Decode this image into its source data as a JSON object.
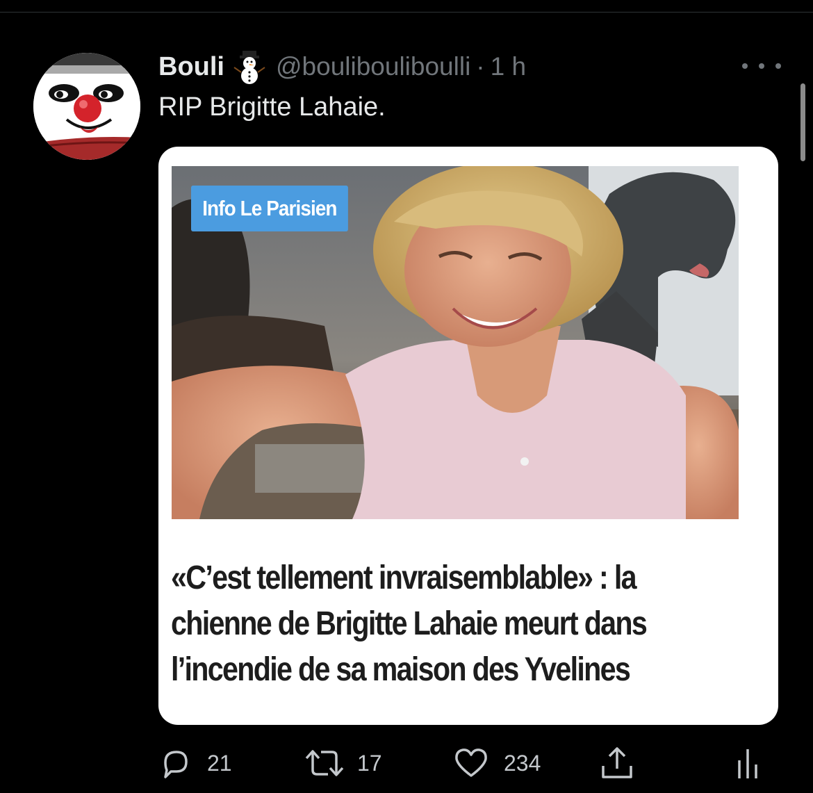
{
  "tweet": {
    "display_name": "Bouli",
    "name_emoji": "snowman-emoji",
    "handle": "@boulibouliboulli",
    "separator": "·",
    "time": "1 h",
    "text": "RIP Brigitte Lahaie."
  },
  "card": {
    "badge": "Info Le Parisien",
    "headline_lines": [
      "«C’est tellement invraisemblable» : la",
      "chienne de Brigitte Lahaie meurt dans",
      "l’incendie de sa maison des Yvelines"
    ]
  },
  "actions": {
    "replies": "21",
    "retweets": "17",
    "likes": "234"
  },
  "icons": {
    "reply": "reply-bubble-icon",
    "retweet": "retweet-arrows-icon",
    "like": "heart-icon",
    "share": "share-upload-icon",
    "analytics": "analytics-bars-icon",
    "more": "more-dots-icon"
  },
  "colors": {
    "background": "#000000",
    "text_primary": "#e7e9ea",
    "text_secondary": "#71767b",
    "badge": "#4b9ce0",
    "card_bg": "#ffffff"
  }
}
